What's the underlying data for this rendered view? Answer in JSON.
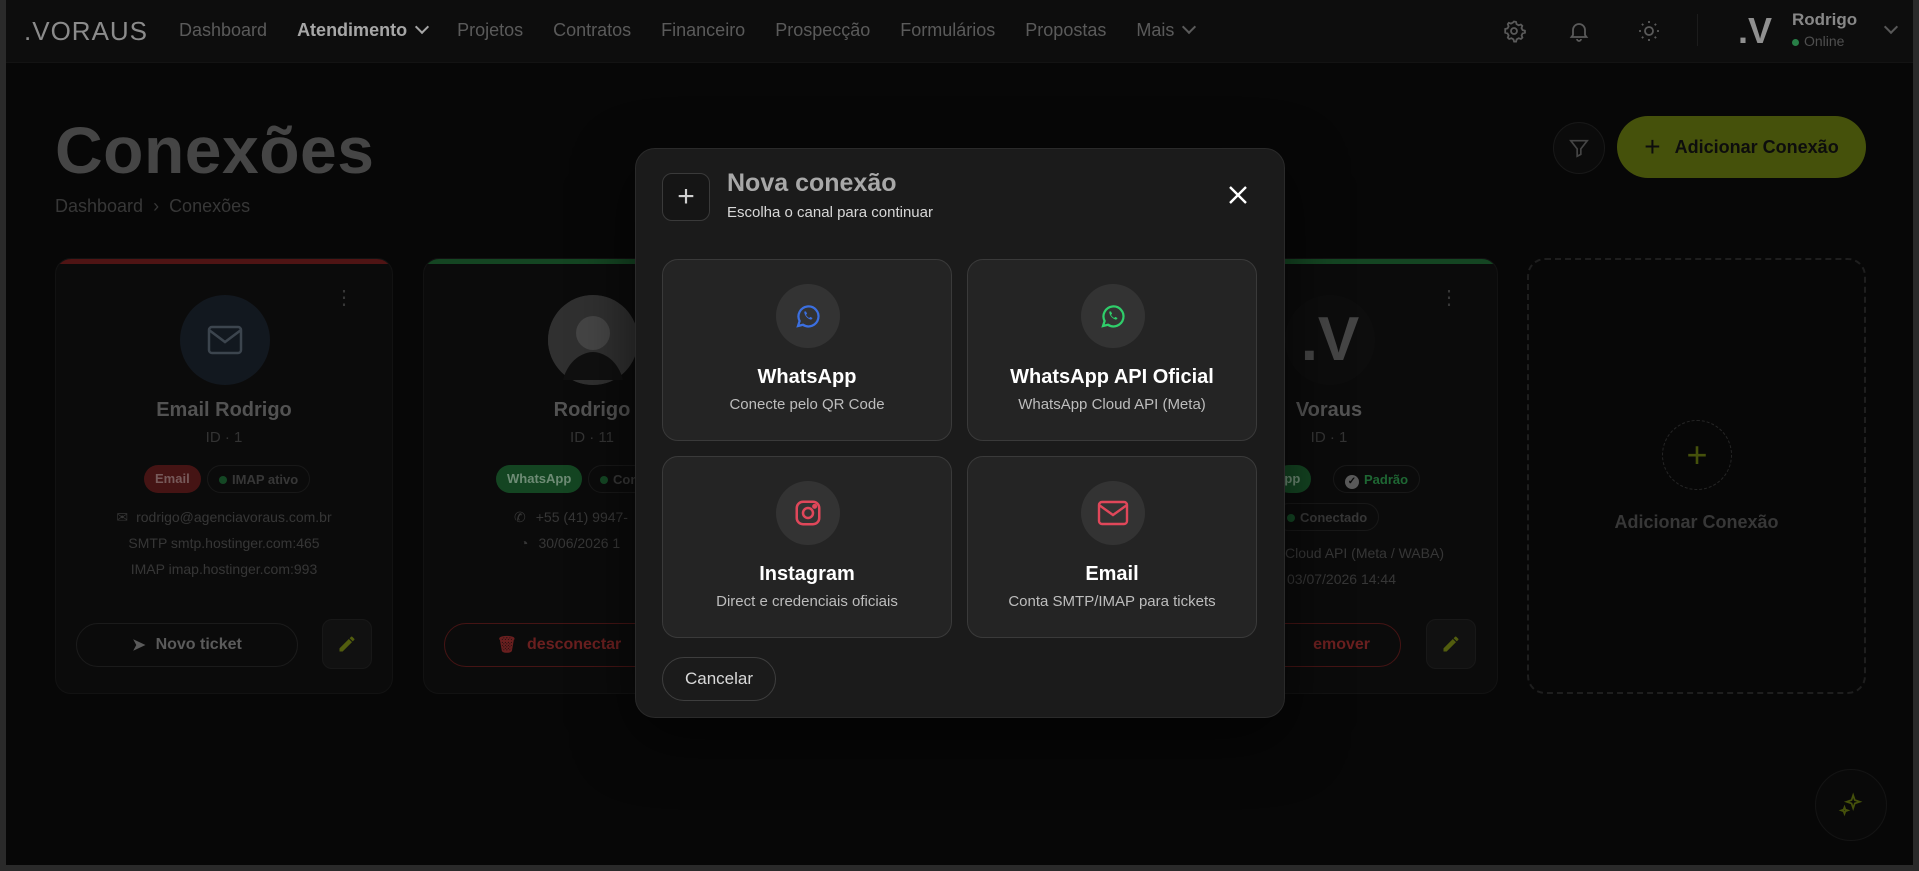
{
  "app": {
    "logo": ".VORAUS"
  },
  "nav": {
    "items": [
      "Dashboard",
      "Atendimento",
      "Projetos",
      "Contratos",
      "Financeiro",
      "Prospecção",
      "Formulários",
      "Propostas",
      "Mais"
    ],
    "active": "Atendimento"
  },
  "user": {
    "avatar": ".V",
    "name": "Rodrigo",
    "status": "Online"
  },
  "page": {
    "title": "Conexões",
    "breadcrumb": [
      "Dashboard",
      "Conexões"
    ],
    "add_button": "Adicionar Conexão"
  },
  "cards": [
    {
      "name": "Email Rodrigo",
      "id": "ID · 1",
      "badges": [
        "Email",
        "IMAP ativo"
      ],
      "lines": [
        "rodrigo@agenciavoraus.com.br",
        "SMTP smtp.hostinger.com:465",
        "IMAP imap.hostinger.com:993"
      ],
      "action": "Novo ticket"
    },
    {
      "name": "Rodrigo",
      "id": "ID · 11",
      "badges": [
        "WhatsApp",
        "Con"
      ],
      "lines": [
        "+55 (41) 9947-",
        "30/06/2026 1"
      ],
      "action": "desconectar"
    },
    {
      "avatar": ".V",
      "name": "Voraus",
      "id": "ID · 1",
      "badges": [
        "App",
        "Padrão",
        "Conectado"
      ],
      "lines": [
        "Cloud API (Meta / WABA)",
        "03/07/2026 14:44"
      ],
      "action": "emover"
    }
  ],
  "add_card": {
    "label": "Adicionar Conexão"
  },
  "modal": {
    "title": "Nova conexão",
    "subtitle": "Escolha o canal para continuar",
    "options": [
      {
        "title": "WhatsApp",
        "subtitle": "Conecte pelo QR Code",
        "icon": "whatsapp-icon"
      },
      {
        "title": "WhatsApp API Oficial",
        "subtitle": "WhatsApp Cloud API (Meta)",
        "icon": "whatsapp-icon"
      },
      {
        "title": "Instagram",
        "subtitle": "Direct e credenciais oficiais",
        "icon": "instagram-icon"
      },
      {
        "title": "Email",
        "subtitle": "Conta SMTP/IMAP para tickets",
        "icon": "mail-icon"
      }
    ],
    "cancel": "Cancelar"
  },
  "colors": {
    "accent": "#6b7d12",
    "danger": "#b83232",
    "success": "#2f9e4f",
    "whatsapp_blue": "#3b6fe0",
    "whatsapp_green": "#2fce6a",
    "instagram": "#e0475a",
    "mail_red": "#e0475a"
  }
}
